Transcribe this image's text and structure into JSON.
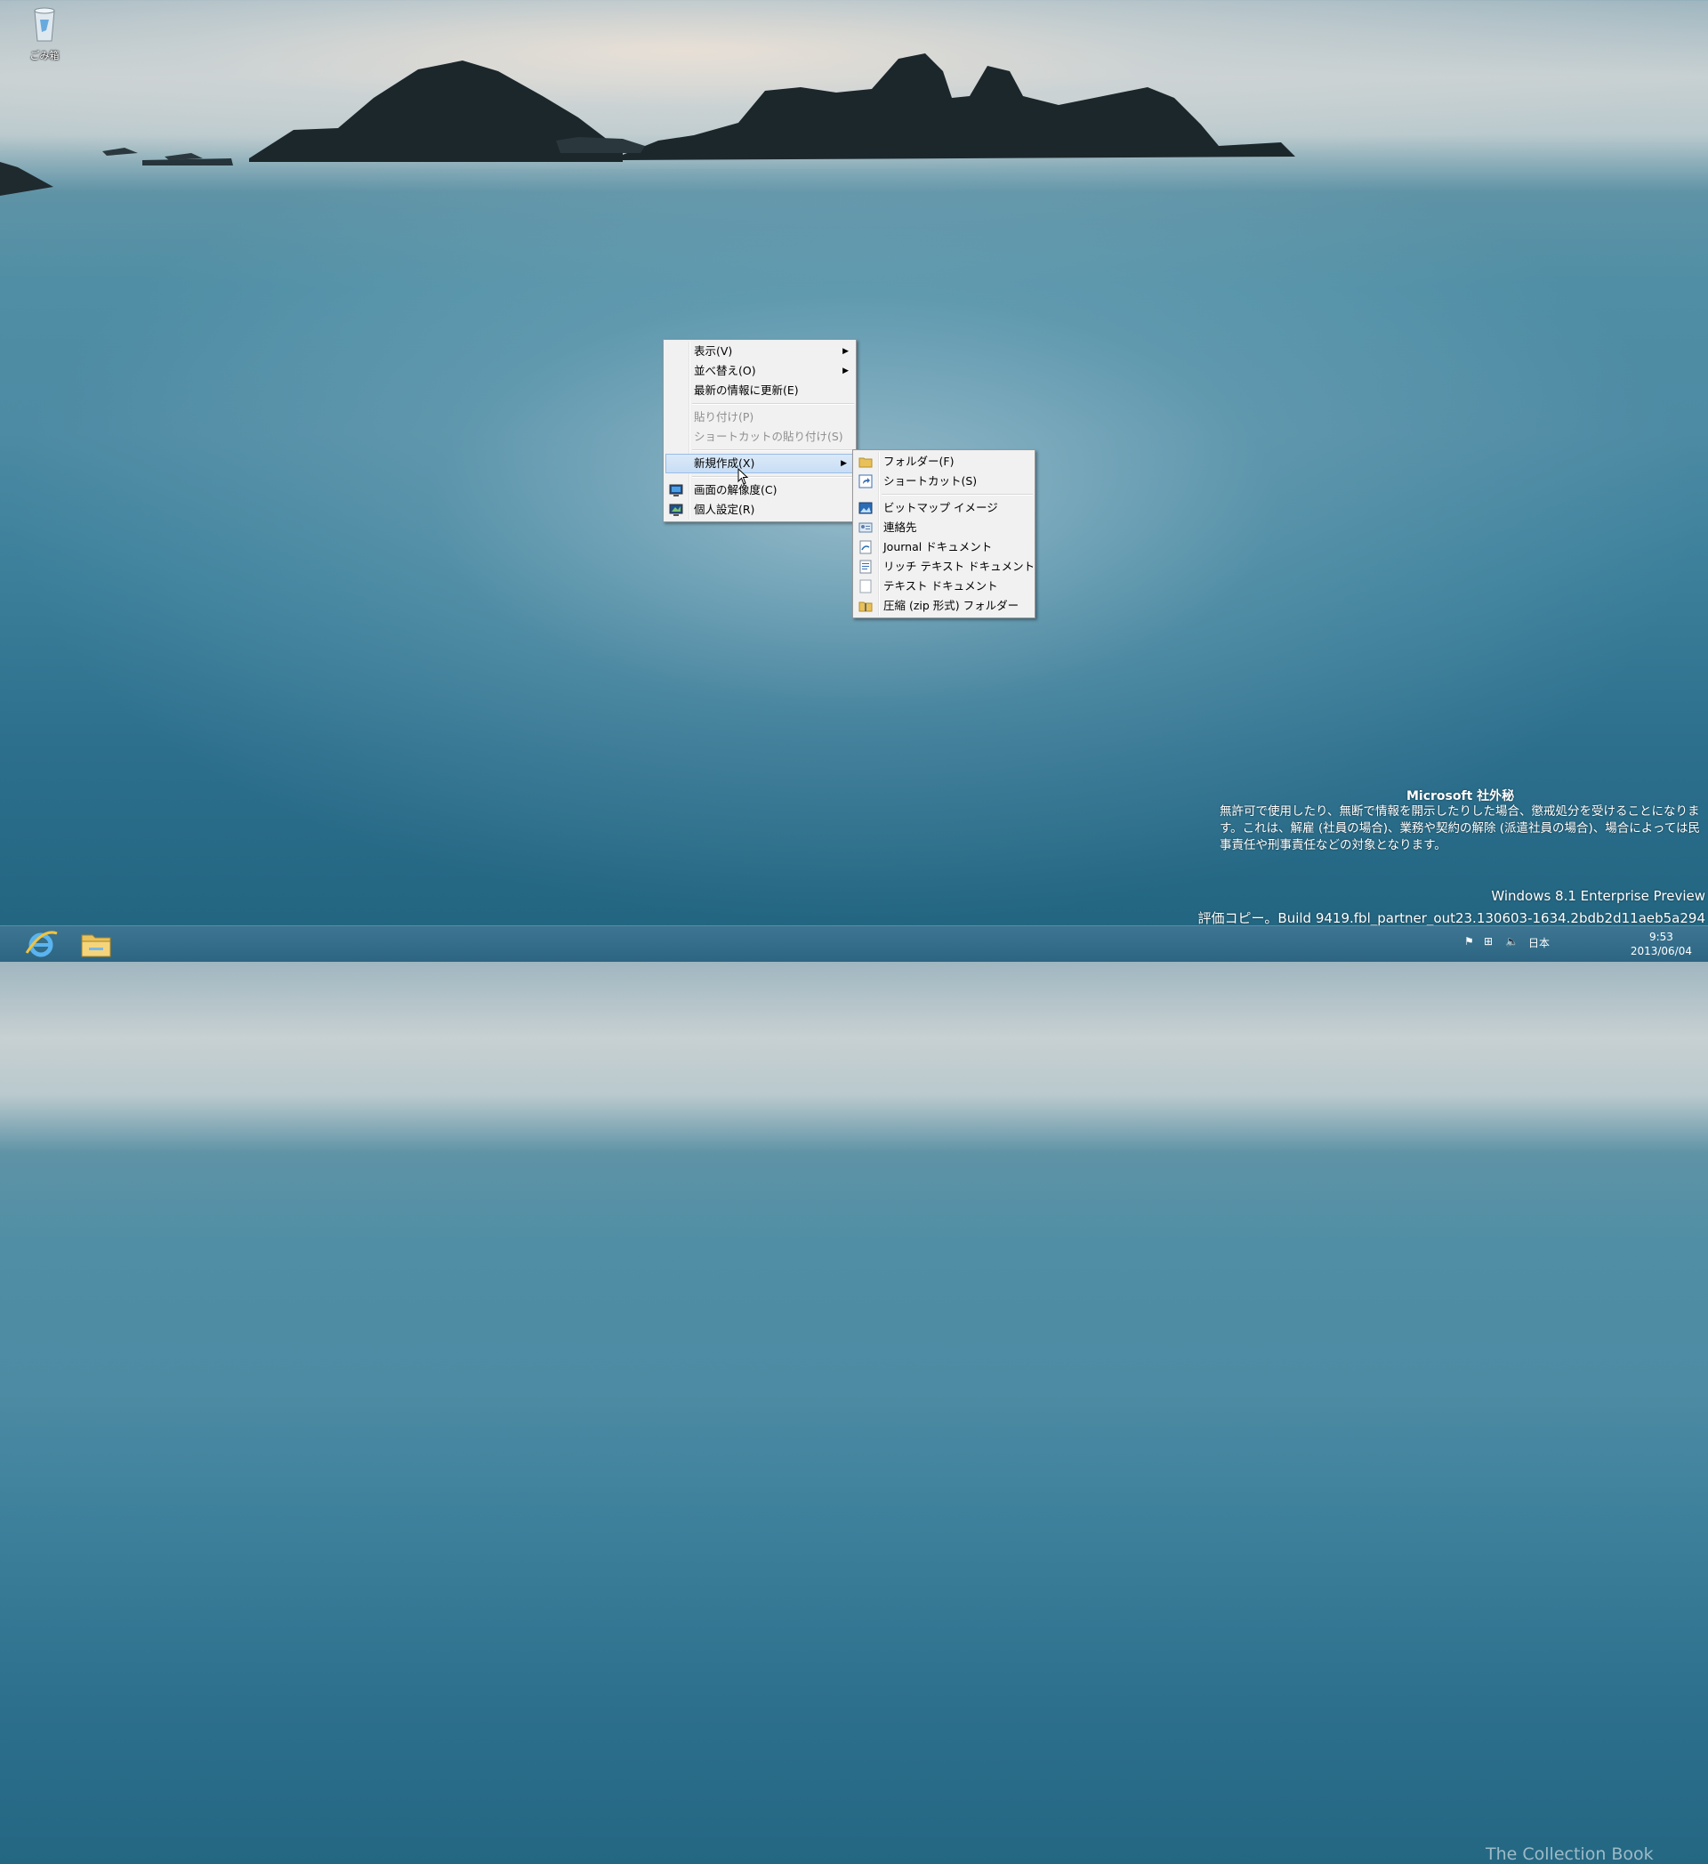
{
  "desktop": {
    "recycle_bin_label": "ごみ箱"
  },
  "context_menu": {
    "items": [
      {
        "label": "表示(V)"
      },
      {
        "label": "並べ替え(O)"
      },
      {
        "label": "最新の情報に更新(E)"
      },
      {
        "label": "貼り付け(P)"
      },
      {
        "label": "ショートカットの貼り付け(S)"
      },
      {
        "label": "新規作成(X)"
      },
      {
        "label": "画面の解像度(C)"
      },
      {
        "label": "個人設定(R)"
      }
    ]
  },
  "new_submenu": {
    "items": [
      {
        "label": "フォルダー(F)"
      },
      {
        "label": "ショートカット(S)"
      },
      {
        "label": "ビットマップ イメージ"
      },
      {
        "label": "連絡先"
      },
      {
        "label": "Journal ドキュメント"
      },
      {
        "label": "リッチ テキスト ドキュメント"
      },
      {
        "label": "テキスト ドキュメント"
      },
      {
        "label": "圧縮 (zip 形式) フォルダー"
      }
    ]
  },
  "watermark": {
    "title": "Microsoft 社外秘",
    "body": "無許可で使用したり、無断で情報を開示したりした場合、懲戒処分を受けることになります。これは、解雇 (社員の場合)、業務や契約の解除 (派遣社員の場合)、場合によっては民事責任や刑事責任などの対象となります。",
    "edition": "Windows 8.1 Enterprise Preview",
    "build": "評価コピー。Build 9419.fbl_partner_out23.130603-1634.2bdb2d11aeb5a294"
  },
  "taskbar": {
    "language": "日本",
    "time": "9:53",
    "date": "2013/06/04",
    "brand_text": "The Collection Book"
  }
}
